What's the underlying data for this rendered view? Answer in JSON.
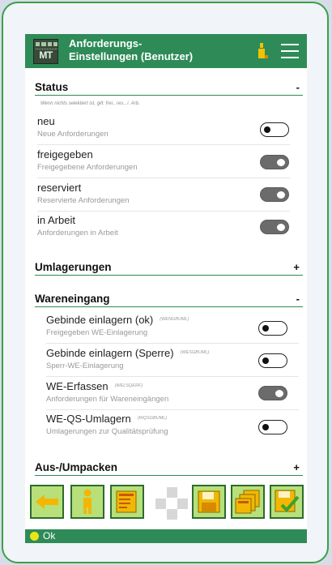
{
  "header": {
    "logo_text": "MT",
    "title_line1": "Anforderungs-",
    "title_line2": "Einstellungen (Benutzer)"
  },
  "sections": {
    "status": {
      "title": "Status",
      "toggle": "-"
    },
    "umlagerungen": {
      "title": "Umlagerungen",
      "toggle": "+"
    },
    "wareneingang": {
      "title": "Wareneingang",
      "toggle": "-"
    },
    "aus_umpacken": {
      "title": "Aus-/Umpacken",
      "toggle": "+"
    }
  },
  "status_hint": "Wenn nichts selektiert ist, gilt: frei., res., i. Arb.",
  "status_rows": [
    {
      "title": "neu",
      "subtitle": "Neue Anforderungen",
      "enabled": false
    },
    {
      "title": "freigegeben",
      "subtitle": "Freigegebene Anforderungen",
      "enabled": true
    },
    {
      "title": "reserviert",
      "subtitle": "Reservierte Anforderungen",
      "enabled": true
    },
    {
      "title": "in Arbeit",
      "subtitle": "Anforderungen in Arbeit",
      "enabled": true
    }
  ],
  "wareneingang_rows": [
    {
      "title": "Gebinde einlagern (ok)",
      "code": "(WENGBUML)",
      "subtitle": "Freigegeben WE-Einlagerung",
      "enabled": false
    },
    {
      "title": "Gebinde einlagern (Sperre)",
      "code": "(WESGBUML)",
      "subtitle": "Sperr-WE-Einlagerung",
      "enabled": false
    },
    {
      "title": "WE-Erfassen",
      "code": "(WELSQERF)",
      "subtitle": "Anforderungen für Wareneingängen",
      "enabled": true
    },
    {
      "title": "WE-QS-Umlagern",
      "code": "(WQSGBUML)",
      "subtitle": "Umlagerungen zur Qualitätsprüfung",
      "enabled": false
    }
  ],
  "status_bar": {
    "text": "Ok"
  },
  "colors": {
    "header_green": "#2e8b57",
    "frame_green": "#3aa049",
    "button_green": "#b7e07a",
    "toggle_on": "#6b6b6b",
    "status_dot": "#e8e619"
  },
  "icons": {
    "toolbar": [
      "arrow-left-icon",
      "person-icon",
      "list-document-icon",
      "nav-cross-icon",
      "save-icon",
      "multi-document-icon",
      "approve-save-icon"
    ],
    "header": [
      "bottle-icon",
      "hamburger-menu-icon"
    ]
  }
}
